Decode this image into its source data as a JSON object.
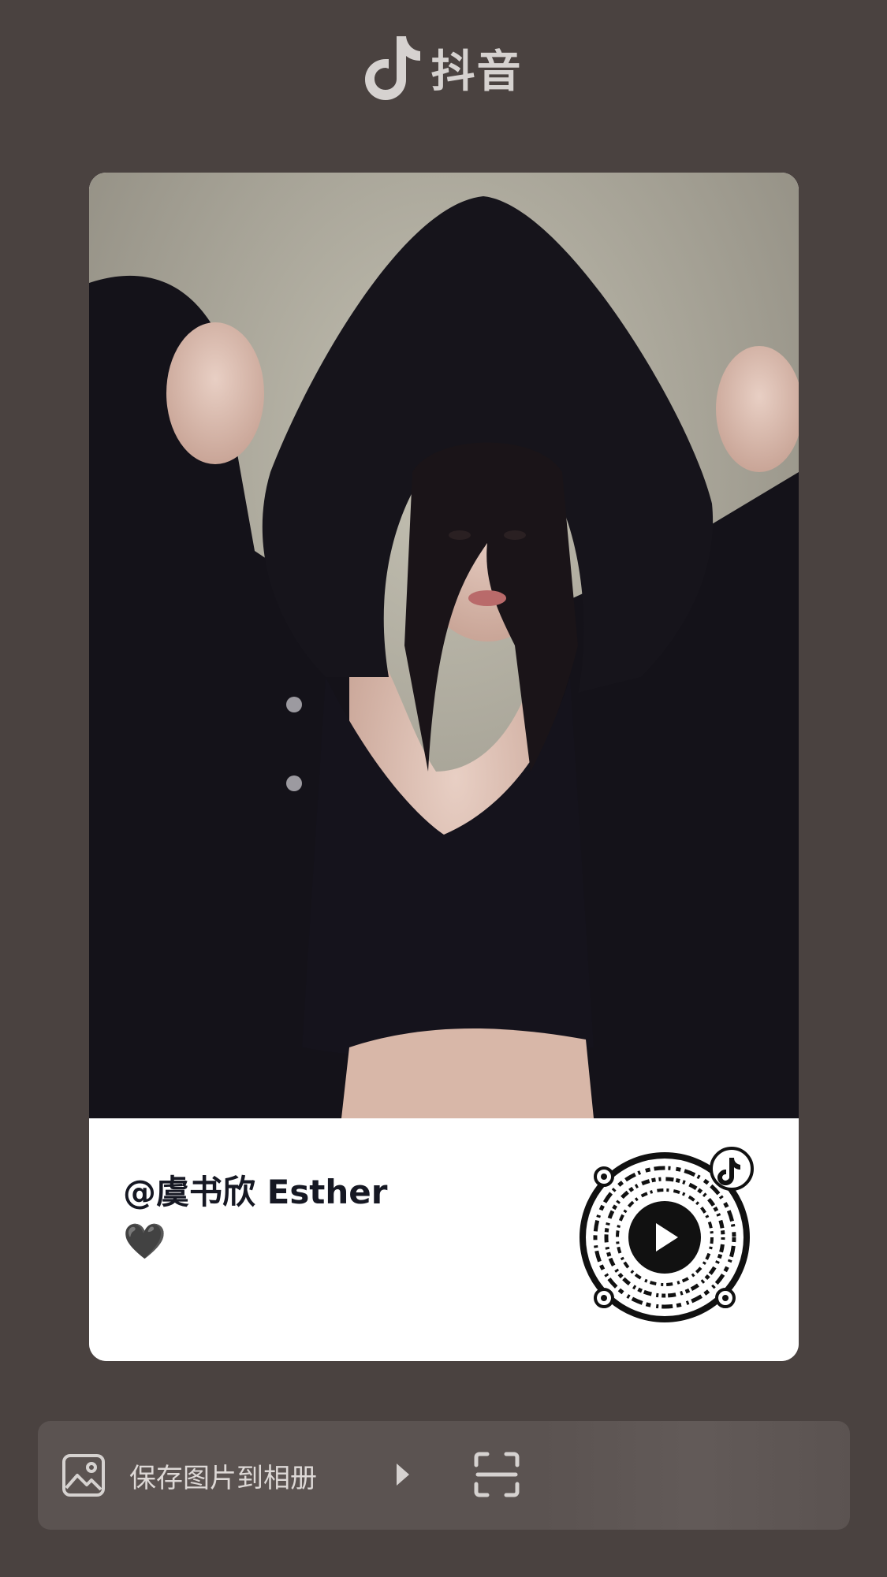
{
  "app": {
    "brand_text": "抖音"
  },
  "card": {
    "username": "@虞书欣 Esther",
    "caption_emoji": "🖤"
  },
  "actions": {
    "save_label": "保存图片到相册"
  },
  "colors": {
    "background": "#4a4240",
    "card": "#ffffff",
    "username_text": "#161823",
    "bottom_bar": "#5b5351"
  },
  "icons": {
    "brand": "douyin-note-icon",
    "save": "image-icon",
    "arrow": "play-arrow-icon",
    "scan": "scan-icon",
    "qr_center": "play-icon"
  }
}
